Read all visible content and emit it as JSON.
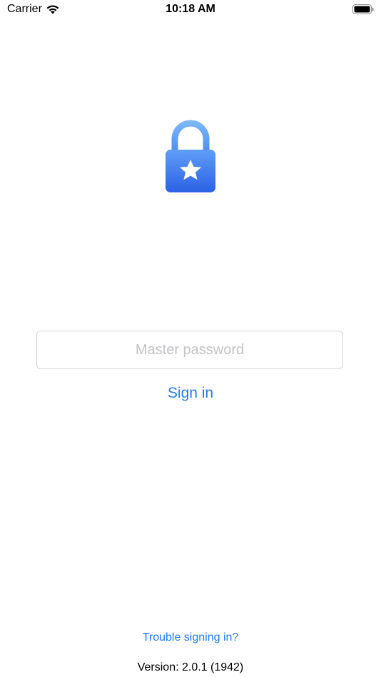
{
  "status_bar": {
    "carrier": "Carrier",
    "time": "10:18 AM",
    "wifi_icon": "wifi-icon",
    "battery_icon": "battery-icon"
  },
  "logo": {
    "icon": "lock-star-icon",
    "gradient_top": "#6aa8f7",
    "gradient_bottom": "#2b63e6"
  },
  "login": {
    "password_placeholder": "Master password",
    "password_value": "",
    "sign_in_label": "Sign in"
  },
  "footer": {
    "trouble_label": "Trouble signing in?",
    "version_text": "Version: 2.0.1 (1942)"
  },
  "colors": {
    "accent": "#1a7ef5",
    "placeholder": "#c4c4c7",
    "field_border": "#d6d6d9"
  }
}
